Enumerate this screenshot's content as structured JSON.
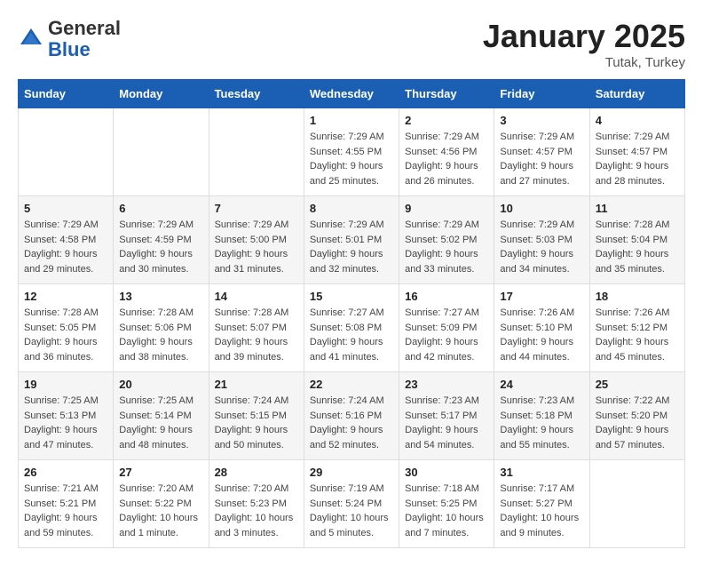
{
  "header": {
    "logo_general": "General",
    "logo_blue": "Blue",
    "month": "January 2025",
    "location": "Tutak, Turkey"
  },
  "days_of_week": [
    "Sunday",
    "Monday",
    "Tuesday",
    "Wednesday",
    "Thursday",
    "Friday",
    "Saturday"
  ],
  "weeks": [
    [
      {
        "day": "",
        "details": ""
      },
      {
        "day": "",
        "details": ""
      },
      {
        "day": "",
        "details": ""
      },
      {
        "day": "1",
        "details": "Sunrise: 7:29 AM\nSunset: 4:55 PM\nDaylight: 9 hours\nand 25 minutes."
      },
      {
        "day": "2",
        "details": "Sunrise: 7:29 AM\nSunset: 4:56 PM\nDaylight: 9 hours\nand 26 minutes."
      },
      {
        "day": "3",
        "details": "Sunrise: 7:29 AM\nSunset: 4:57 PM\nDaylight: 9 hours\nand 27 minutes."
      },
      {
        "day": "4",
        "details": "Sunrise: 7:29 AM\nSunset: 4:57 PM\nDaylight: 9 hours\nand 28 minutes."
      }
    ],
    [
      {
        "day": "5",
        "details": "Sunrise: 7:29 AM\nSunset: 4:58 PM\nDaylight: 9 hours\nand 29 minutes."
      },
      {
        "day": "6",
        "details": "Sunrise: 7:29 AM\nSunset: 4:59 PM\nDaylight: 9 hours\nand 30 minutes."
      },
      {
        "day": "7",
        "details": "Sunrise: 7:29 AM\nSunset: 5:00 PM\nDaylight: 9 hours\nand 31 minutes."
      },
      {
        "day": "8",
        "details": "Sunrise: 7:29 AM\nSunset: 5:01 PM\nDaylight: 9 hours\nand 32 minutes."
      },
      {
        "day": "9",
        "details": "Sunrise: 7:29 AM\nSunset: 5:02 PM\nDaylight: 9 hours\nand 33 minutes."
      },
      {
        "day": "10",
        "details": "Sunrise: 7:29 AM\nSunset: 5:03 PM\nDaylight: 9 hours\nand 34 minutes."
      },
      {
        "day": "11",
        "details": "Sunrise: 7:28 AM\nSunset: 5:04 PM\nDaylight: 9 hours\nand 35 minutes."
      }
    ],
    [
      {
        "day": "12",
        "details": "Sunrise: 7:28 AM\nSunset: 5:05 PM\nDaylight: 9 hours\nand 36 minutes."
      },
      {
        "day": "13",
        "details": "Sunrise: 7:28 AM\nSunset: 5:06 PM\nDaylight: 9 hours\nand 38 minutes."
      },
      {
        "day": "14",
        "details": "Sunrise: 7:28 AM\nSunset: 5:07 PM\nDaylight: 9 hours\nand 39 minutes."
      },
      {
        "day": "15",
        "details": "Sunrise: 7:27 AM\nSunset: 5:08 PM\nDaylight: 9 hours\nand 41 minutes."
      },
      {
        "day": "16",
        "details": "Sunrise: 7:27 AM\nSunset: 5:09 PM\nDaylight: 9 hours\nand 42 minutes."
      },
      {
        "day": "17",
        "details": "Sunrise: 7:26 AM\nSunset: 5:10 PM\nDaylight: 9 hours\nand 44 minutes."
      },
      {
        "day": "18",
        "details": "Sunrise: 7:26 AM\nSunset: 5:12 PM\nDaylight: 9 hours\nand 45 minutes."
      }
    ],
    [
      {
        "day": "19",
        "details": "Sunrise: 7:25 AM\nSunset: 5:13 PM\nDaylight: 9 hours\nand 47 minutes."
      },
      {
        "day": "20",
        "details": "Sunrise: 7:25 AM\nSunset: 5:14 PM\nDaylight: 9 hours\nand 48 minutes."
      },
      {
        "day": "21",
        "details": "Sunrise: 7:24 AM\nSunset: 5:15 PM\nDaylight: 9 hours\nand 50 minutes."
      },
      {
        "day": "22",
        "details": "Sunrise: 7:24 AM\nSunset: 5:16 PM\nDaylight: 9 hours\nand 52 minutes."
      },
      {
        "day": "23",
        "details": "Sunrise: 7:23 AM\nSunset: 5:17 PM\nDaylight: 9 hours\nand 54 minutes."
      },
      {
        "day": "24",
        "details": "Sunrise: 7:23 AM\nSunset: 5:18 PM\nDaylight: 9 hours\nand 55 minutes."
      },
      {
        "day": "25",
        "details": "Sunrise: 7:22 AM\nSunset: 5:20 PM\nDaylight: 9 hours\nand 57 minutes."
      }
    ],
    [
      {
        "day": "26",
        "details": "Sunrise: 7:21 AM\nSunset: 5:21 PM\nDaylight: 9 hours\nand 59 minutes."
      },
      {
        "day": "27",
        "details": "Sunrise: 7:20 AM\nSunset: 5:22 PM\nDaylight: 10 hours\nand 1 minute."
      },
      {
        "day": "28",
        "details": "Sunrise: 7:20 AM\nSunset: 5:23 PM\nDaylight: 10 hours\nand 3 minutes."
      },
      {
        "day": "29",
        "details": "Sunrise: 7:19 AM\nSunset: 5:24 PM\nDaylight: 10 hours\nand 5 minutes."
      },
      {
        "day": "30",
        "details": "Sunrise: 7:18 AM\nSunset: 5:25 PM\nDaylight: 10 hours\nand 7 minutes."
      },
      {
        "day": "31",
        "details": "Sunrise: 7:17 AM\nSunset: 5:27 PM\nDaylight: 10 hours\nand 9 minutes."
      },
      {
        "day": "",
        "details": ""
      }
    ]
  ]
}
